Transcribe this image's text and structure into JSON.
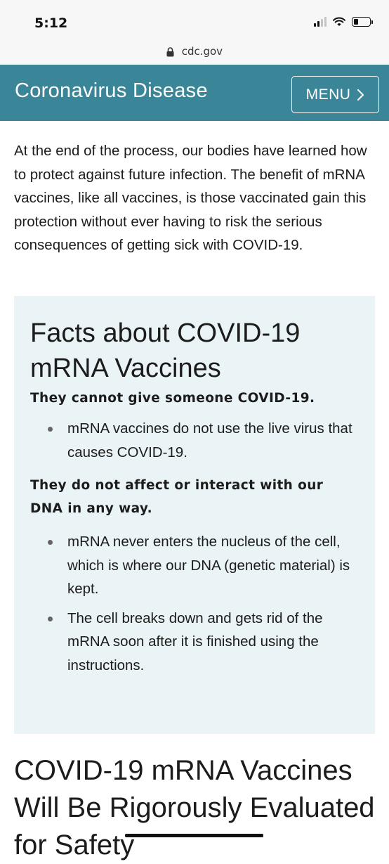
{
  "status_bar": {
    "time": "5:12"
  },
  "browser": {
    "url": "cdc.gov"
  },
  "header": {
    "title": "Coronavirus Disease",
    "menu_label": "MENU"
  },
  "intro": {
    "text": "At the end of the process, our bodies have learned how to protect against future infection. The benefit of mRNA vaccines, like all vaccines, is those vaccinated gain this protection without ever having to risk the serious consequences of getting sick with COVID-19."
  },
  "facts": {
    "title": "Facts about COVID-19 mRNA Vaccines",
    "groups": [
      {
        "heading": "They cannot give someone COVID-19.",
        "bullets": [
          "mRNA vaccines do not use the live virus that causes COVID-19."
        ]
      },
      {
        "heading": "They do not affect or interact with our DNA in any way.",
        "bullets": [
          "mRNA never enters the nucleus of the cell, which is where our DNA (genetic material) is kept.",
          "The cell breaks down and gets rid of the mRNA soon after it is finished using the instructions."
        ]
      }
    ]
  },
  "next_section": {
    "title": "COVID-19 mRNA Vaccines Will Be Rigorously Evaluated for Safety"
  },
  "colors": {
    "header_bg": "#3a8597",
    "facts_bg": "#eaf4f6"
  },
  "icons": [
    "signal-icon",
    "wifi-icon",
    "battery-icon",
    "lock-icon",
    "chevron-right-icon"
  ]
}
